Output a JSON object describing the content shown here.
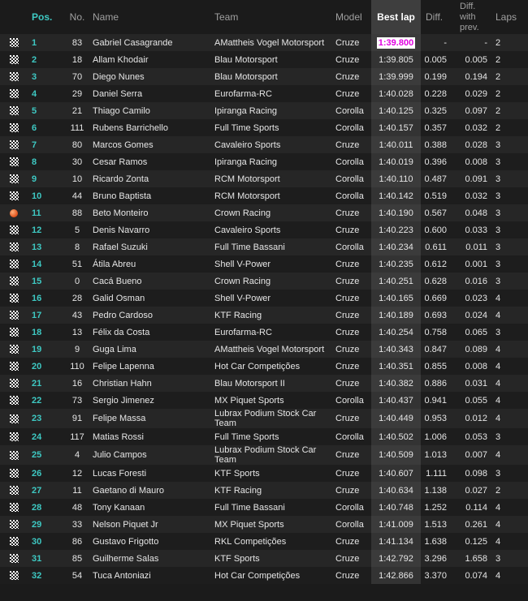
{
  "headers": {
    "pos": "Pos.",
    "no": "No.",
    "name": "Name",
    "team": "Team",
    "model": "Model",
    "best_lap": "Best lap",
    "diff": "Diff.",
    "diff_prev_1": "Diff.",
    "diff_prev_2": "with",
    "diff_prev_3": "prev.",
    "laps": "Laps"
  },
  "colors": {
    "accent": "#3ec9c3",
    "fastest": "#e000e0",
    "pit_dot": "#e0501a"
  },
  "rows": [
    {
      "pos": "1",
      "no": "83",
      "name": "Gabriel Casagrande",
      "team": "AMattheis Vogel Motorsport",
      "model": "Cruze",
      "best": "1:39.800",
      "diff": "-",
      "diffp": "-",
      "laps": "2",
      "icon": "checkered-flag",
      "fastest": true
    },
    {
      "pos": "2",
      "no": "18",
      "name": "Allam Khodair",
      "team": "Blau Motorsport",
      "model": "Cruze",
      "best": "1:39.805",
      "diff": "0.005",
      "diffp": "0.005",
      "laps": "2",
      "icon": "checkered-flag"
    },
    {
      "pos": "3",
      "no": "70",
      "name": "Diego Nunes",
      "team": "Blau Motorsport",
      "model": "Cruze",
      "best": "1:39.999",
      "diff": "0.199",
      "diffp": "0.194",
      "laps": "2",
      "icon": "checkered-flag"
    },
    {
      "pos": "4",
      "no": "29",
      "name": "Daniel Serra",
      "team": "Eurofarma-RC",
      "model": "Cruze",
      "best": "1:40.028",
      "diff": "0.228",
      "diffp": "0.029",
      "laps": "2",
      "icon": "checkered-flag"
    },
    {
      "pos": "5",
      "no": "21",
      "name": "Thiago Camilo",
      "team": "Ipiranga Racing",
      "model": "Corolla",
      "best": "1:40.125",
      "diff": "0.325",
      "diffp": "0.097",
      "laps": "2",
      "icon": "checkered-flag"
    },
    {
      "pos": "6",
      "no": "111",
      "name": "Rubens Barrichello",
      "team": "Full Time Sports",
      "model": "Corolla",
      "best": "1:40.157",
      "diff": "0.357",
      "diffp": "0.032",
      "laps": "2",
      "icon": "checkered-flag"
    },
    {
      "pos": "7",
      "no": "80",
      "name": "Marcos Gomes",
      "team": "Cavaleiro Sports",
      "model": "Cruze",
      "best": "1:40.011",
      "diff": "0.388",
      "diffp": "0.028",
      "laps": "3",
      "icon": "checkered-flag"
    },
    {
      "pos": "8",
      "no": "30",
      "name": "Cesar Ramos",
      "team": "Ipiranga Racing",
      "model": "Corolla",
      "best": "1:40.019",
      "diff": "0.396",
      "diffp": "0.008",
      "laps": "3",
      "icon": "checkered-flag"
    },
    {
      "pos": "9",
      "no": "10",
      "name": "Ricardo Zonta",
      "team": "RCM Motorsport",
      "model": "Corolla",
      "best": "1:40.110",
      "diff": "0.487",
      "diffp": "0.091",
      "laps": "3",
      "icon": "checkered-flag"
    },
    {
      "pos": "10",
      "no": "44",
      "name": "Bruno Baptista",
      "team": "RCM Motorsport",
      "model": "Corolla",
      "best": "1:40.142",
      "diff": "0.519",
      "diffp": "0.032",
      "laps": "3",
      "icon": "checkered-flag"
    },
    {
      "pos": "11",
      "no": "88",
      "name": "Beto Monteiro",
      "team": "Crown Racing",
      "model": "Cruze",
      "best": "1:40.190",
      "diff": "0.567",
      "diffp": "0.048",
      "laps": "3",
      "icon": "orange-dot"
    },
    {
      "pos": "12",
      "no": "5",
      "name": "Denis Navarro",
      "team": "Cavaleiro Sports",
      "model": "Cruze",
      "best": "1:40.223",
      "diff": "0.600",
      "diffp": "0.033",
      "laps": "3",
      "icon": "checkered-flag"
    },
    {
      "pos": "13",
      "no": "8",
      "name": "Rafael Suzuki",
      "team": "Full Time Bassani",
      "model": "Corolla",
      "best": "1:40.234",
      "diff": "0.611",
      "diffp": "0.011",
      "laps": "3",
      "icon": "checkered-flag"
    },
    {
      "pos": "14",
      "no": "51",
      "name": "Átila Abreu",
      "team": "Shell V-Power",
      "model": "Cruze",
      "best": "1:40.235",
      "diff": "0.612",
      "diffp": "0.001",
      "laps": "3",
      "icon": "checkered-flag"
    },
    {
      "pos": "15",
      "no": "0",
      "name": "Cacá Bueno",
      "team": "Crown Racing",
      "model": "Cruze",
      "best": "1:40.251",
      "diff": "0.628",
      "diffp": "0.016",
      "laps": "3",
      "icon": "checkered-flag"
    },
    {
      "pos": "16",
      "no": "28",
      "name": "Galid Osman",
      "team": "Shell V-Power",
      "model": "Cruze",
      "best": "1:40.165",
      "diff": "0.669",
      "diffp": "0.023",
      "laps": "4",
      "icon": "checkered-flag"
    },
    {
      "pos": "17",
      "no": "43",
      "name": "Pedro Cardoso",
      "team": "KTF Racing",
      "model": "Cruze",
      "best": "1:40.189",
      "diff": "0.693",
      "diffp": "0.024",
      "laps": "4",
      "icon": "checkered-flag"
    },
    {
      "pos": "18",
      "no": "13",
      "name": "Félix da Costa",
      "team": "Eurofarma-RC",
      "model": "Cruze",
      "best": "1:40.254",
      "diff": "0.758",
      "diffp": "0.065",
      "laps": "3",
      "icon": "checkered-flag"
    },
    {
      "pos": "19",
      "no": "9",
      "name": "Guga Lima",
      "team": "AMattheis Vogel Motorsport",
      "model": "Cruze",
      "best": "1:40.343",
      "diff": "0.847",
      "diffp": "0.089",
      "laps": "4",
      "icon": "checkered-flag"
    },
    {
      "pos": "20",
      "no": "110",
      "name": "Felipe Lapenna",
      "team": "Hot Car Competições",
      "model": "Cruze",
      "best": "1:40.351",
      "diff": "0.855",
      "diffp": "0.008",
      "laps": "4",
      "icon": "checkered-flag"
    },
    {
      "pos": "21",
      "no": "16",
      "name": "Christian Hahn",
      "team": "Blau Motorsport II",
      "model": "Cruze",
      "best": "1:40.382",
      "diff": "0.886",
      "diffp": "0.031",
      "laps": "4",
      "icon": "checkered-flag"
    },
    {
      "pos": "22",
      "no": "73",
      "name": "Sergio Jimenez",
      "team": "MX Piquet Sports",
      "model": "Corolla",
      "best": "1:40.437",
      "diff": "0.941",
      "diffp": "0.055",
      "laps": "4",
      "icon": "checkered-flag"
    },
    {
      "pos": "23",
      "no": "91",
      "name": "Felipe Massa",
      "team": "Lubrax Podium Stock Car Team",
      "model": "Cruze",
      "best": "1:40.449",
      "diff": "0.953",
      "diffp": "0.012",
      "laps": "4",
      "icon": "checkered-flag",
      "wrap": true
    },
    {
      "pos": "24",
      "no": "117",
      "name": "Matias Rossi",
      "team": "Full Time Sports",
      "model": "Corolla",
      "best": "1:40.502",
      "diff": "1.006",
      "diffp": "0.053",
      "laps": "3",
      "icon": "checkered-flag"
    },
    {
      "pos": "25",
      "no": "4",
      "name": "Julio Campos",
      "team": "Lubrax Podium Stock Car Team",
      "model": "Cruze",
      "best": "1:40.509",
      "diff": "1.013",
      "diffp": "0.007",
      "laps": "4",
      "icon": "checkered-flag",
      "wrap": true
    },
    {
      "pos": "26",
      "no": "12",
      "name": "Lucas Foresti",
      "team": "KTF Sports",
      "model": "Cruze",
      "best": "1:40.607",
      "diff": "1.111",
      "diffp": "0.098",
      "laps": "3",
      "icon": "checkered-flag"
    },
    {
      "pos": "27",
      "no": "11",
      "name": "Gaetano di Mauro",
      "team": "KTF Racing",
      "model": "Cruze",
      "best": "1:40.634",
      "diff": "1.138",
      "diffp": "0.027",
      "laps": "2",
      "icon": "checkered-flag"
    },
    {
      "pos": "28",
      "no": "48",
      "name": "Tony Kanaan",
      "team": "Full Time Bassani",
      "model": "Corolla",
      "best": "1:40.748",
      "diff": "1.252",
      "diffp": "0.114",
      "laps": "4",
      "icon": "checkered-flag"
    },
    {
      "pos": "29",
      "no": "33",
      "name": "Nelson Piquet Jr",
      "team": "MX Piquet Sports",
      "model": "Corolla",
      "best": "1:41.009",
      "diff": "1.513",
      "diffp": "0.261",
      "laps": "4",
      "icon": "checkered-flag"
    },
    {
      "pos": "30",
      "no": "86",
      "name": "Gustavo Frigotto",
      "team": "RKL Competições",
      "model": "Cruze",
      "best": "1:41.134",
      "diff": "1.638",
      "diffp": "0.125",
      "laps": "4",
      "icon": "checkered-flag"
    },
    {
      "pos": "31",
      "no": "85",
      "name": "Guilherme Salas",
      "team": "KTF Sports",
      "model": "Cruze",
      "best": "1:42.792",
      "diff": "3.296",
      "diffp": "1.658",
      "laps": "3",
      "icon": "checkered-flag"
    },
    {
      "pos": "32",
      "no": "54",
      "name": "Tuca Antoniazi",
      "team": "Hot Car Competições",
      "model": "Cruze",
      "best": "1:42.866",
      "diff": "3.370",
      "diffp": "0.074",
      "laps": "4",
      "icon": "checkered-flag"
    }
  ]
}
